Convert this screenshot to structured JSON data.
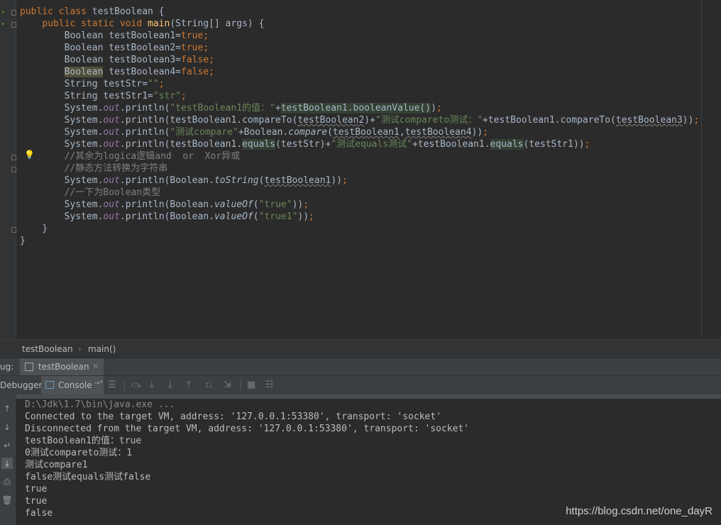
{
  "editor": {
    "lines": [
      "public class testBoolean {",
      "    public static void main(String[] args) {",
      "        Boolean testBoolean1=true;",
      "        Boolean testBoolean2=true;",
      "        Boolean testBoolean3=false;",
      "        Boolean testBoolean4=false;",
      "        String testStr=\"\";",
      "        String testStr1=\"str\";",
      "        System.out.println(\"testBoolean1的值：\"+testBoolean1.booleanValue());",
      "        System.out.println(testBoolean1.compareTo(testBoolean2)+\"测试compareto测试：\"+testBoolean1.compareTo(testBoolean3));",
      "        System.out.println(\"测试compare\"+Boolean.compare(testBoolean1,testBoolean4));",
      "        System.out.println(testBoolean1.equals(testStr)+\"测试equals测试\"+testBoolean1.equals(testStr1));",
      "        //其余为logica逻辑and  or  Xor异或",
      "        //静态方法转换为字符串",
      "        System.out.println(Boolean.toString(testBoolean1));",
      "        //一下为Boolean类型",
      "        System.out.println(Boolean.valueOf(\"true\"));",
      "        System.out.println(Boolean.valueOf(\"true1\"));",
      "    }",
      "}"
    ]
  },
  "breadcrumb": {
    "class": "testBoolean",
    "sep": "›",
    "method": "main()"
  },
  "debug": {
    "label": "ug:",
    "tab": "testBoolean",
    "close": "×"
  },
  "console_toolbar": {
    "debugger": "Debugger",
    "console": "Console",
    "pin": "→*"
  },
  "console": {
    "lines": [
      "D:\\Jdk\\1.7\\bin\\java.exe ...",
      "Connected to the target VM, address: '127.0.0.1:53380', transport: 'socket'",
      "Disconnected from the target VM, address: '127.0.0.1:53380', transport: 'socket'",
      "testBoolean1的值：true",
      "0测试compareto测试：1",
      "测试compare1",
      "false测试equals测试false",
      "true",
      "true",
      "false"
    ]
  },
  "watermark": "https://blog.csdn.net/one_dayR",
  "colors": {
    "keyword": "#cc7832",
    "string": "#6a8759",
    "comment": "#808080",
    "static_field": "#9876aa",
    "method_decl": "#ffc66d"
  }
}
